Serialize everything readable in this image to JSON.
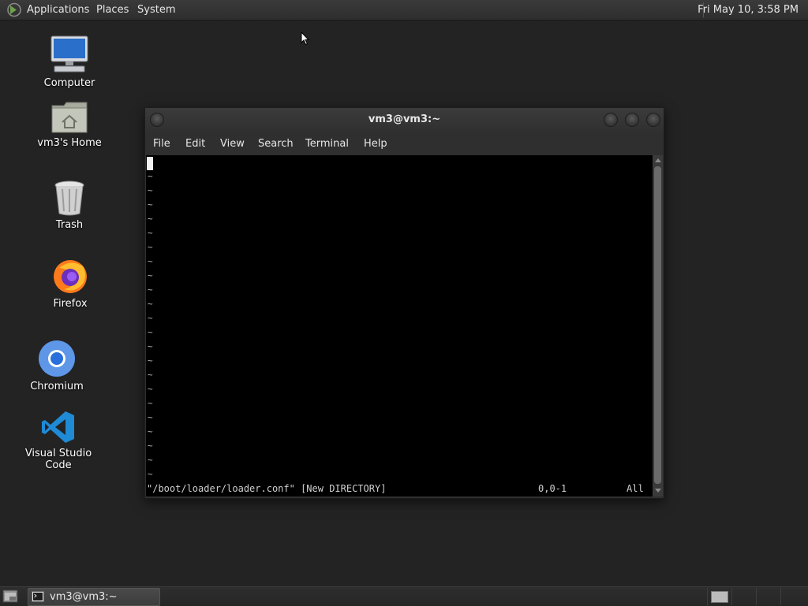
{
  "top_panel": {
    "menus": [
      "Applications",
      "Places",
      "System"
    ],
    "clock": "Fri May 10,  3:58 PM"
  },
  "desktop_icons": [
    {
      "label": "Computer",
      "icon": "computer-icon"
    },
    {
      "label": "vm3's Home",
      "icon": "home-folder-icon"
    },
    {
      "label": "Trash",
      "icon": "trash-icon"
    },
    {
      "label": "Firefox",
      "icon": "firefox-icon"
    },
    {
      "label": "Chromium",
      "icon": "chromium-icon"
    },
    {
      "label": "Visual Studio Code",
      "icon": "vscode-icon"
    }
  ],
  "terminal": {
    "title": "vm3@vm3:~",
    "menu": [
      "File",
      "Edit",
      "View",
      "Search",
      "Terminal",
      "Help"
    ],
    "tilde_char": "~",
    "status_file": "\"/boot/loader/loader.conf\" [New DIRECTORY]",
    "status_position": "0,0-1",
    "status_scroll": "All"
  },
  "taskbar": {
    "window_title": "vm3@vm3:~"
  },
  "colors": {
    "desktop": "#232323",
    "terminal_bg": "#000000",
    "panel": "#2e2e2e"
  }
}
